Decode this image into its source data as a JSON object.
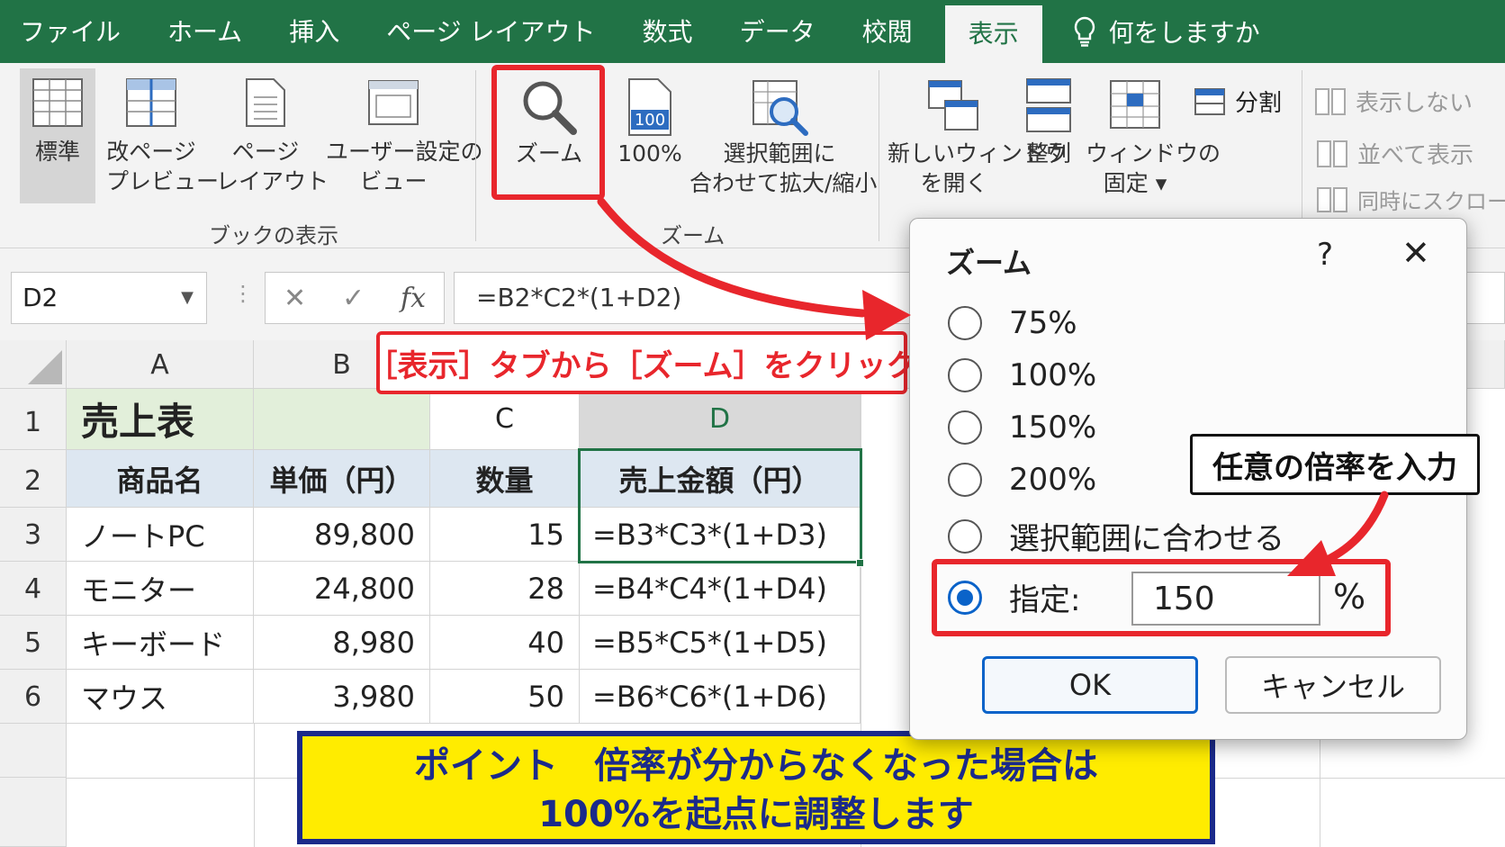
{
  "tabs": [
    "ファイル",
    "ホーム",
    "挿入",
    "ページ レイアウト",
    "数式",
    "データ",
    "校閲",
    "表示"
  ],
  "active_tab": "表示",
  "tell_me": "何をしますか",
  "ribbon": {
    "normal": "標準",
    "page_break_1": "改ページ",
    "page_break_2": "プレビュー",
    "page_layout_1": "ページ",
    "page_layout_2": "レイアウト",
    "custom_view_1": "ユーザー設定の",
    "custom_view_2": "ビュー",
    "book_view_group": "ブックの表示",
    "zoom": "ズーム",
    "zoom_100": "100%",
    "zoom_100_icon_text": "100",
    "zoom_selection_1": "選択範囲に",
    "zoom_selection_2": "合わせて拡大/縮小",
    "zoom_group": "ズーム",
    "new_window_1": "新しいウィンドウ",
    "new_window_2": "を開く",
    "arrange": "整列",
    "freeze_1": "ウィンドウの",
    "freeze_2": "固定 ▾",
    "split": "分割",
    "hide": "表示しない",
    "side_by_side": "並べて表示",
    "sync_scroll": "同時にスクロール"
  },
  "formula_bar": {
    "name_box": "D2",
    "cancel": "✕",
    "enter": "✓",
    "fx": "fx",
    "formula": "=B2*C2*(1+D2)"
  },
  "sheet": {
    "columns": [
      "A",
      "B",
      "C",
      "D"
    ],
    "rows": [
      "1",
      "2",
      "3",
      "4",
      "5",
      "6"
    ],
    "title": "売上表",
    "c1": "C",
    "d1": "D",
    "headers": [
      "商品名",
      "単価（円）",
      "数量",
      "売上金額（円）"
    ],
    "data": [
      [
        "ノートPC",
        "89,800",
        "15",
        "=B3*C3*(1+D3)"
      ],
      [
        "モニター",
        "24,800",
        "28",
        "=B4*C4*(1+D4)"
      ],
      [
        "キーボード",
        "8,980",
        "40",
        "=B5*C5*(1+D5)"
      ],
      [
        "マウス",
        "3,980",
        "50",
        "=B6*C6*(1+D6)"
      ]
    ]
  },
  "callout_tab": "［表示］タブから［ズーム］をクリック",
  "callout_input": "任意の倍率を入力",
  "point_line1": "ポイント　倍率が分からなくなった場合は",
  "point_line2": "100%を起点に調整します",
  "dialog": {
    "title": "ズーム",
    "help": "?",
    "close": "✕",
    "options": [
      "75%",
      "100%",
      "150%",
      "200%",
      "選択範囲に合わせる"
    ],
    "custom_label": "指定:",
    "custom_value": "150",
    "percent": "%",
    "ok": "OK",
    "cancel": "キャンセル"
  },
  "colors": {
    "excel_green": "#217346",
    "highlight_red": "#e8262c",
    "point_yellow": "#ffec00",
    "point_navy": "#1b2a8a",
    "selected_blue": "#0a63c9"
  }
}
